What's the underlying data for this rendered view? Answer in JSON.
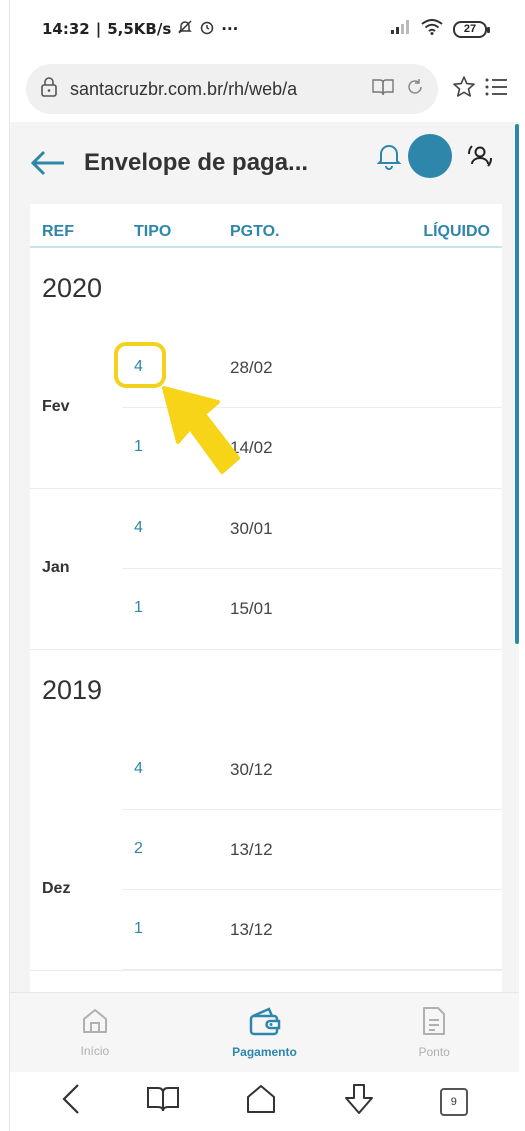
{
  "status_bar": {
    "time": "14:32",
    "speed": "5,5KB/s",
    "more": "···",
    "battery": "27"
  },
  "browser": {
    "url": "santacruzbr.com.br/rh/web/a",
    "tab_count": "9"
  },
  "header": {
    "title": "Envelope de paga..."
  },
  "table": {
    "headers": {
      "ref": "REF",
      "tipo": "TIPO",
      "pgto": "PGTO.",
      "liquido": "LÍQUIDO"
    },
    "years": [
      {
        "year": "2020",
        "months": [
          {
            "month": "Fev",
            "rows": [
              {
                "tipo": "4",
                "pgto": "28/02"
              },
              {
                "tipo": "1",
                "pgto": "14/02"
              }
            ]
          },
          {
            "month": "Jan",
            "rows": [
              {
                "tipo": "4",
                "pgto": "30/01"
              },
              {
                "tipo": "1",
                "pgto": "15/01"
              }
            ]
          }
        ]
      },
      {
        "year": "2019",
        "months": [
          {
            "month": "Dez",
            "rows": [
              {
                "tipo": "4",
                "pgto": "30/12"
              },
              {
                "tipo": "2",
                "pgto": "13/12"
              },
              {
                "tipo": "1",
                "pgto": "13/12"
              }
            ]
          }
        ]
      }
    ]
  },
  "bottom_nav": {
    "inicio": "Início",
    "pagamento": "Pagamento",
    "ponto": "Ponto"
  },
  "colors": {
    "accent": "#2e86ab",
    "highlight": "#f2d21c"
  }
}
